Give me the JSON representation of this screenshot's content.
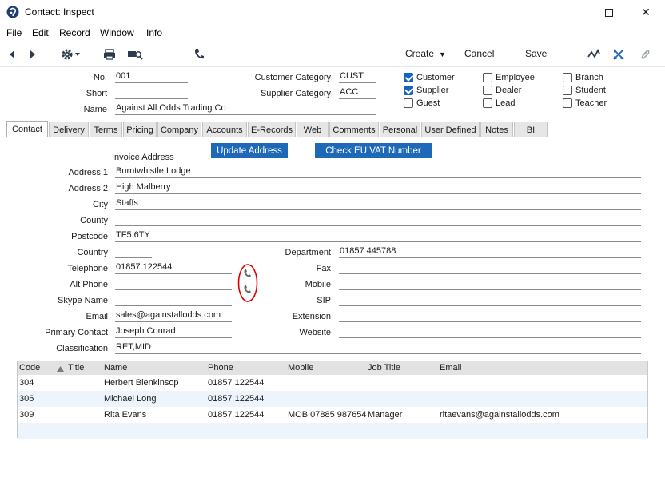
{
  "window": {
    "title": "Contact: Inspect"
  },
  "menu": [
    "File",
    "Edit",
    "Record",
    "Window",
    "Info"
  ],
  "toolbar": {
    "create_label": "Create",
    "cancel_label": "Cancel",
    "save_label": "Save"
  },
  "header": {
    "no_label": "No.",
    "no_value": "001",
    "short_label": "Short",
    "short_value": "",
    "name_label": "Name",
    "name_value": "Against All Odds Trading Co",
    "custcat_label": "Customer Category",
    "custcat_value": "CUST",
    "suppcat_label": "Supplier Category",
    "suppcat_value": "ACC"
  },
  "checkboxes": [
    {
      "label": "Customer",
      "checked": true
    },
    {
      "label": "Supplier",
      "checked": true
    },
    {
      "label": "Guest",
      "checked": false
    },
    {
      "label": "Employee",
      "checked": false
    },
    {
      "label": "Dealer",
      "checked": false
    },
    {
      "label": "Lead",
      "checked": false
    },
    {
      "label": "Branch",
      "checked": false
    },
    {
      "label": "Student",
      "checked": false
    },
    {
      "label": "Teacher",
      "checked": false
    }
  ],
  "tabs": [
    "Contact",
    "Delivery",
    "Terms",
    "Pricing",
    "Company",
    "Accounts",
    "E-Records",
    "Web",
    "Comments",
    "Personal",
    "User Defined",
    "Notes",
    "BI"
  ],
  "active_tab": "Contact",
  "buttons": {
    "update_address": "Update Address",
    "check_vat": "Check EU VAT Number"
  },
  "contact": {
    "invoice_address_label": "Invoice Address",
    "address1_label": "Address 1",
    "address1": "Burntwhistle Lodge",
    "address2_label": "Address 2",
    "address2": "High Malberry",
    "city_label": "City",
    "city": "Staffs",
    "county_label": "County",
    "county": "",
    "postcode_label": "Postcode",
    "postcode": "TF5 6TY",
    "country_label": "Country",
    "country": "",
    "telephone_label": "Telephone",
    "telephone": "01857 122544",
    "altphone_label": "Alt Phone",
    "altphone": "",
    "skype_label": "Skype Name",
    "skype": "",
    "email_label": "Email",
    "email": "sales@againstallodds.com",
    "primary_label": "Primary Contact",
    "primary": "Joseph Conrad",
    "class_label": "Classification",
    "class": "RET,MID",
    "dept_label": "Department",
    "dept": "01857 445788",
    "fax_label": "Fax",
    "fax": "",
    "mobile_label": "Mobile",
    "mobile": "",
    "sip_label": "SIP",
    "sip": "",
    "ext_label": "Extension",
    "ext": "",
    "website_label": "Website",
    "website": ""
  },
  "grid": {
    "headers": [
      "Code",
      "Title",
      "Name",
      "Phone",
      "Mobile",
      "Job Title",
      "Email"
    ],
    "rows": [
      [
        "304",
        "",
        "Herbert Blenkinsop",
        "01857 122544",
        "",
        "",
        ""
      ],
      [
        "306",
        "",
        "Michael Long",
        "01857 122544",
        "",
        "",
        ""
      ],
      [
        "309",
        "",
        "Rita Evans",
        "01857 122544",
        "MOB 07885 987654",
        "Manager",
        "ritaevans@againstallodds.com"
      ]
    ]
  },
  "colors": {
    "accent": "#1e68b8",
    "annotation_circle": "#e00000",
    "checkbox_checked": "#1565c0"
  }
}
